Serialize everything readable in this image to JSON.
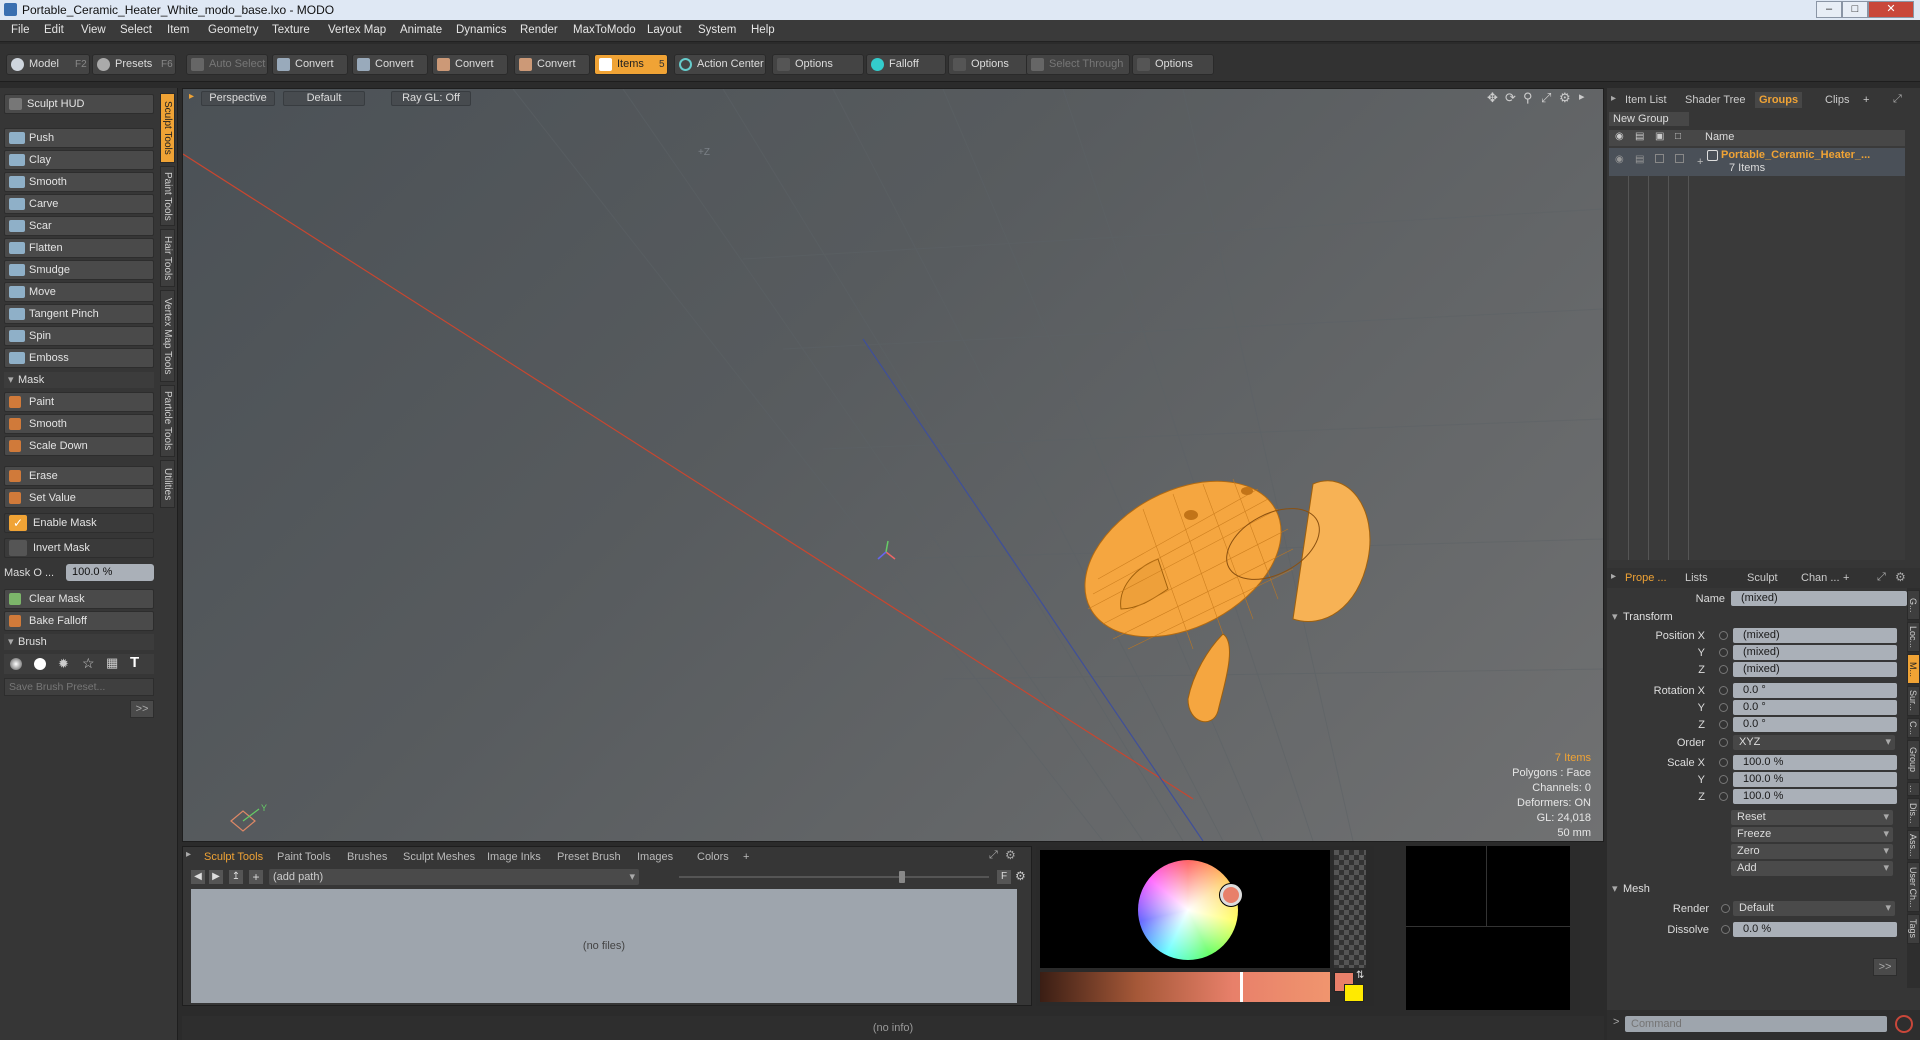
{
  "window": {
    "title": "Portable_Ceramic_Heater_White_modo_base.lxo - MODO"
  },
  "menu": [
    "File",
    "Edit",
    "View",
    "Select",
    "Item",
    "Geometry",
    "Texture",
    "Vertex Map",
    "Animate",
    "Dynamics",
    "Render",
    "MaxToModo",
    "Layout",
    "System",
    "Help"
  ],
  "toolbar": {
    "model": "Model",
    "model_key": "F2",
    "presets": "Presets",
    "presets_key": "F6",
    "auto_select": "Auto Select",
    "convert1": "Convert",
    "convert2": "Convert",
    "convert3": "Convert",
    "convert4": "Convert",
    "items": "Items",
    "items_key": "5",
    "action_center": "Action Center",
    "options1": "Options",
    "falloff": "Falloff",
    "options2": "Options",
    "select_through": "Select Through",
    "options3": "Options"
  },
  "left": {
    "hud": "Sculpt HUD",
    "tools": [
      "Push",
      "Clay",
      "Smooth",
      "Carve",
      "Scar",
      "Flatten",
      "Smudge",
      "Move",
      "Tangent Pinch",
      "Spin",
      "Emboss"
    ],
    "mask_header": "Mask",
    "mask_tools": [
      "Paint",
      "Smooth",
      "Scale Down"
    ],
    "erase": "Erase",
    "set_value": "Set Value",
    "enable_mask": "Enable Mask",
    "invert_mask": "Invert Mask",
    "mask_opacity_label": "Mask O ...",
    "mask_opacity_value": "100.0 %",
    "clear_mask": "Clear Mask",
    "bake_falloff": "Bake Falloff",
    "brush_header": "Brush",
    "save_preset": "Save Brush Preset...",
    "more": ">>"
  },
  "side_tabs": [
    "Sculpt Tools",
    "Paint Tools",
    "Hair Tools",
    "Vertex Map Tools",
    "Particle Tools",
    "Utilities"
  ],
  "viewport": {
    "view": "Perspective",
    "shading": "Default",
    "raygl": "Ray GL: Off",
    "axis_label": "+Z",
    "stats": {
      "items": "7 Items",
      "polygons": "Polygons : Face",
      "channels": "Channels: 0",
      "deformers": "Deformers: ON",
      "gl": "GL: 24,018",
      "size": "50 mm"
    }
  },
  "bottom": {
    "tabs": [
      "Sculpt Tools",
      "Paint Tools",
      "Brushes",
      "Sculpt Meshes",
      "Image Inks",
      "Preset Brush",
      "Images",
      "Colors",
      "+"
    ],
    "path": "(add path)",
    "nofiles": "(no files)",
    "f_label": "F"
  },
  "status": "(no info)",
  "right": {
    "tabs": [
      "Item List",
      "Shader Tree",
      "Groups",
      "Clips",
      "+"
    ],
    "new_group": "New Group",
    "name_col": "Name",
    "group_name": "Portable_Ceramic_Heater_...",
    "group_count": "7 Items",
    "prop_tabs": [
      "Prope ...",
      "Lists",
      "Sculpt",
      "Chan ...",
      "+"
    ],
    "name_label": "Name",
    "name_value": "(mixed)",
    "transform": "Transform",
    "position": [
      {
        "label": "Position X",
        "value": "(mixed)"
      },
      {
        "label": "Y",
        "value": "(mixed)"
      },
      {
        "label": "Z",
        "value": "(mixed)"
      }
    ],
    "rotation": [
      {
        "label": "Rotation X",
        "value": "0.0 °"
      },
      {
        "label": "Y",
        "value": "0.0 °"
      },
      {
        "label": "Z",
        "value": "0.0 °"
      }
    ],
    "order_label": "Order",
    "order_value": "XYZ",
    "scale": [
      {
        "label": "Scale X",
        "value": "100.0 %"
      },
      {
        "label": "Y",
        "value": "100.0 %"
      },
      {
        "label": "Z",
        "value": "100.0 %"
      }
    ],
    "actions": [
      "Reset",
      "Freeze",
      "Zero",
      "Add"
    ],
    "mesh": "Mesh",
    "render_label": "Render",
    "render_value": "Default",
    "dissolve_label": "Dissolve",
    "dissolve_value": "0.0 %",
    "more": ">>",
    "command_placeholder": "Command",
    "side_tabs": [
      "G...",
      "Loc...",
      "M...",
      "Sur...",
      "C...",
      "Group",
      "...",
      "Dis...",
      "Ass...",
      "User Ch...",
      "Tags"
    ]
  },
  "colors": {
    "accent": "#f0a335",
    "model": "#f5a640",
    "wire": "#b36a10"
  }
}
